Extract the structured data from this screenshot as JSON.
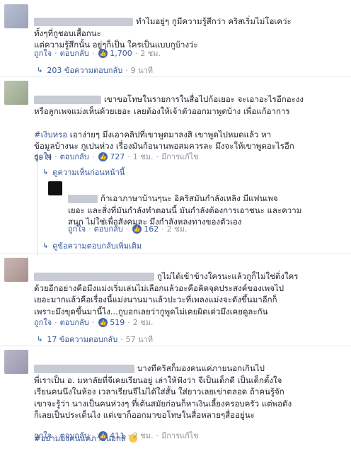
{
  "comments": [
    {
      "name": "",
      "text_line1": "ทำไมอยู่ๆ กูมีความรู้สึกว่า คริสเริ่มไม่โอเคว่ะ",
      "text_rest": "ทั้งๆที่กูชอบเสื้อกนะ\nแต่ความรู้สึกนั้น อยู่ๆก็เป็น ใครเป็นแบบกูบ้างว่ะ",
      "like": "ถูกใจ",
      "reply": "ตอบกลับ",
      "likes": "1,700",
      "time": "2 ชม.",
      "replies_link": "203 ข้อความตอบกลับ",
      "replies_time": "9 นาที"
    },
    {
      "text_line1": "เขาขอโทษในรายการในสื่อไปก้อเยอะ จะเอาอะไรอีกอะงง",
      "text_rest": "หรือลูกเพจแม่งเห็นด้วยเยอะ เลยต้องให้เจ้าตัวออกมาพูดบ้าง เพื่อแก้อาการ",
      "hashtag": "#เงิบหรอ",
      "text_after_hashtag": " เอาง่ายๆ มึงเอาคลิปที่เขาพูดมาลงสิ เขาพูดไปหมดแล้ว หา\nข้อมูลบ้างนะ กูเปนห่วง เรื่องมันก้อนานพอสมควรละ มึงจะให้เขาพูดอะไรอีก\nว่ะ !!",
      "like": "ถูกใจ",
      "reply": "ตอบกลับ",
      "likes": "727",
      "time": "1 ชม.",
      "edited": "มีการแก้ไข",
      "prev_link": "ดูความเห็นก่อนหน้านี้",
      "reply_item": {
        "text_line1": "ก้าเอาภาษาบ้านๆนะ อิคริสมันกำลังเหลิง มีแฟนเพจ",
        "text_rest": "เยอะ และสิ่งที่มันกำลังทำตอนนี้ มันกำลังต้องการเอาชนะ และความ\nสนุก ไม่ใช่เพื่อสังคมละ มึงกำลังหลงทางของตัวเอง",
        "like": "ถูกใจ",
        "reply": "ตอบกลับ",
        "likes": "162",
        "time": "2 ชม."
      },
      "more_link": "ดูข้อความตอบกลับเพิ่มเติม"
    },
    {
      "text_line1": "กูไม่ได้เข้าข้างใครนะแล้วกูก็ไม่ใช่ติ่งใคร",
      "text_rest": "ด้วยอีกอย่างคือมึงแม่งเริ่มเล่นไม่เลือกแล้วอะคือคิดจุดประสงค์ของเพจไป\nเยอะมากแล้วคือเรื่องนี้แม่งนานมาแล้วปะวะที่เพลงแม่งจะดังขึ้นมาอีกก็\nเพราะมึงขุดขึ้นมานี้ไง...กูบอกเลยว่ากูพูดไม่เคยผิดเด่วมึงเคยดูละกัน",
      "like": "ถูกใจ",
      "reply": "ตอบกลับ",
      "likes": "519",
      "time": "2 ชม.",
      "replies_link": "17 ข้อความตอบกลับ",
      "replies_time": "57 นาที"
    },
    {
      "text_line1": "บางทีคริสก็มองคนแค่ภายนอกเกินไป",
      "text_rest": "พี่เราเป็น อ. มหาลัยที่จีเคยเรียนอยู่ เล่าให้ฟังว่า จีเป็นเด็กดี เป็นเด็กตั้งใจ\nเรียนคนนึงในห้อง เวลาเรียนจีไม่ได้ใส่สั้น ใส่ยาวเลยเข่าตลอด ถ้าคนรู้จัก\nเขาจะรู้ว่า นางเป็นคนห่วงๆ ที่เต้นสมัยก่อนก็หาเงินเลี้ยงครอบครัว แต่พอดัง\nก็เลยเป็นประเด็นไง แต่เขาก็ออกมาขอโทษในสื่อหลายๆสื่ออยู่นะ",
      "hashtag": "#อย่ามองคนแค่ภายนอกสิ",
      "like": "ถูกใจ",
      "reply": "ตอบกลับ",
      "likes": "411",
      "time": "2 ชม.",
      "edited": "มีการแก้ไข"
    }
  ],
  "colors": {
    "link": "#365899",
    "meta": "#90949c",
    "text": "#1d2129",
    "like_blue": "#4267b2"
  },
  "icons": {
    "like": "thumbs-up-icon",
    "reply_arrow": "reply-arrow-icon",
    "emoji": "smile-emoji-icon"
  }
}
